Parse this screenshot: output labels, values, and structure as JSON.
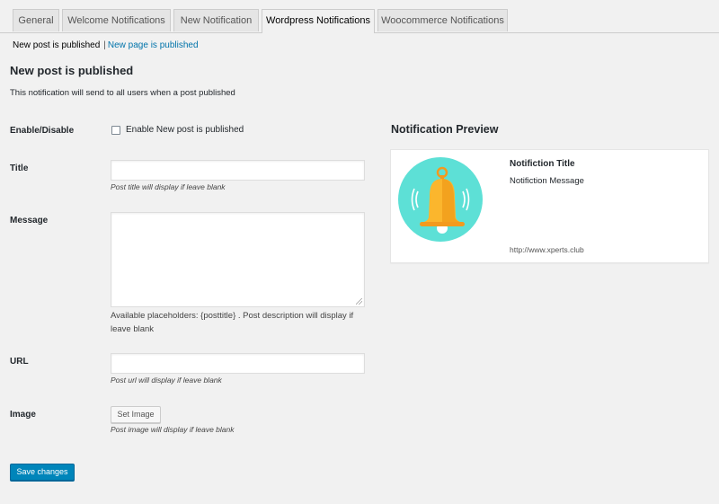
{
  "tabs": [
    {
      "label": "General",
      "active": false
    },
    {
      "label": "Welcome Notifications",
      "active": false
    },
    {
      "label": "New Notification",
      "active": false
    },
    {
      "label": "Wordpress Notifications",
      "active": true
    },
    {
      "label": "Woocommerce Notifications",
      "active": false
    }
  ],
  "subnav": {
    "current": "New post is published",
    "separator": "|",
    "link": "New page is published"
  },
  "section": {
    "title": "New post is published",
    "description": "This notification will send to all users when a post published"
  },
  "form": {
    "enable": {
      "label": "Enable/Disable",
      "checkbox_label": "Enable New post is published",
      "checked": false
    },
    "title": {
      "label": "Title",
      "value": "",
      "placeholder": "",
      "hint": "Post title will display if leave blank"
    },
    "message": {
      "label": "Message",
      "value": "",
      "hint": "Available placeholders: {posttitle} . Post description will display if leave blank"
    },
    "url": {
      "label": "URL",
      "value": "",
      "placeholder": "",
      "hint": "Post url will display if leave blank"
    },
    "image": {
      "label": "Image",
      "button_label": "Set Image",
      "hint": "Post image will display if leave blank"
    },
    "save_label": "Save changes"
  },
  "preview": {
    "heading": "Notification Preview",
    "icon": "bell-icon",
    "title": "Notifiction Title",
    "message": "Notifiction Message",
    "url": "http://www.xperts.club"
  },
  "colors": {
    "primary": "#0085ba",
    "link": "#0073aa",
    "bell_bg": "#5de0d6",
    "bell": "#fbb62d"
  }
}
